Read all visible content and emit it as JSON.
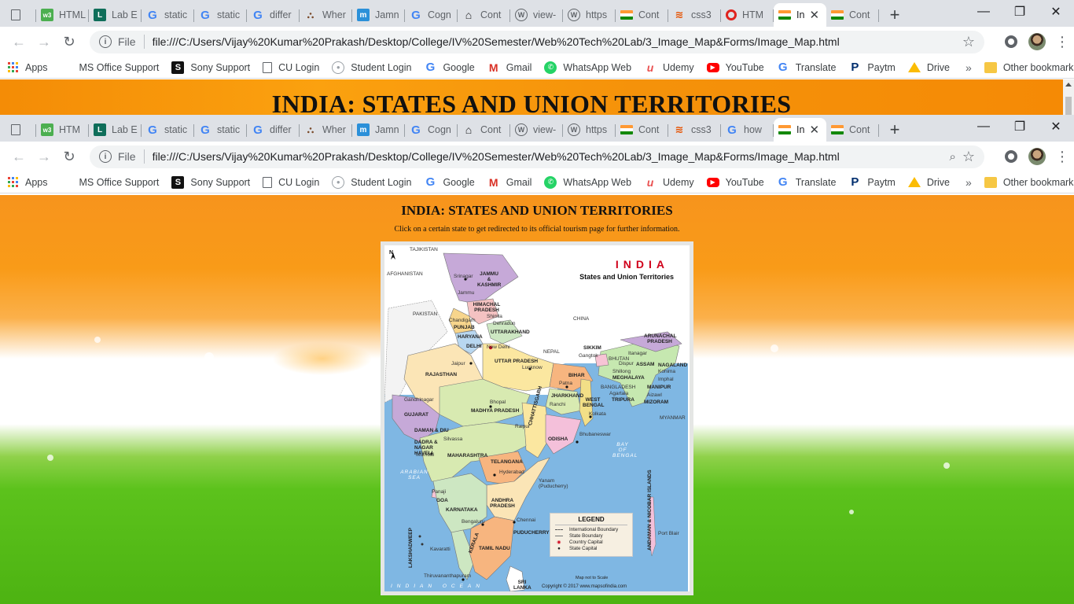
{
  "outer_window": {
    "tabs": [
      {
        "icon": "page-icon",
        "label": ""
      },
      {
        "icon": "w3schools-icon",
        "label": "HTML"
      },
      {
        "icon": "lab-icon",
        "label": "Lab E"
      },
      {
        "icon": "google-icon",
        "label": "static"
      },
      {
        "icon": "google-icon",
        "label": "static"
      },
      {
        "icon": "google-icon",
        "label": "differ"
      },
      {
        "icon": "where-icon",
        "label": "Wher"
      },
      {
        "icon": "m-icon",
        "label": "Jamn"
      },
      {
        "icon": "google-icon",
        "label": "Cogn"
      },
      {
        "icon": "house-icon",
        "label": "Cont"
      },
      {
        "icon": "wordpress-icon",
        "label": "view-"
      },
      {
        "icon": "wordpress-icon",
        "label": "https"
      },
      {
        "icon": "india-flag-icon",
        "label": "Cont"
      },
      {
        "icon": "css-icon",
        "label": "css3"
      },
      {
        "icon": "opera-icon",
        "label": "HTM"
      },
      {
        "icon": "india-flag-icon",
        "label": "In",
        "active": true
      },
      {
        "icon": "india-flag-icon",
        "label": "Cont"
      }
    ],
    "url": "file:///C:/Users/Vijay%20Kumar%20Prakash/Desktop/College/IV%20Semester/Web%20Tech%20Lab/3_Image_Map&Forms/Image_Map.html",
    "file_label": "File",
    "page_heading": "INDIA: STATES AND UNION TERRITORIES"
  },
  "inner_window": {
    "tabs": [
      {
        "icon": "page-icon",
        "label": ""
      },
      {
        "icon": "w3schools-icon",
        "label": "HTM"
      },
      {
        "icon": "lab-icon",
        "label": "Lab E"
      },
      {
        "icon": "google-icon",
        "label": "static"
      },
      {
        "icon": "google-icon",
        "label": "static"
      },
      {
        "icon": "google-icon",
        "label": "differ"
      },
      {
        "icon": "where-icon",
        "label": "Wher"
      },
      {
        "icon": "m-icon",
        "label": "Jamn"
      },
      {
        "icon": "google-icon",
        "label": "Cogn"
      },
      {
        "icon": "house-icon",
        "label": "Cont"
      },
      {
        "icon": "wordpress-icon",
        "label": "view-"
      },
      {
        "icon": "wordpress-icon",
        "label": "https"
      },
      {
        "icon": "india-flag-icon",
        "label": "Cont"
      },
      {
        "icon": "css-icon",
        "label": "css3"
      },
      {
        "icon": "google-icon",
        "label": "how"
      },
      {
        "icon": "india-flag-icon",
        "label": "In",
        "active": true
      },
      {
        "icon": "india-flag-icon",
        "label": "Cont"
      }
    ],
    "url": "file:///C:/Users/Vijay%20Kumar%20Prakash/Desktop/College/IV%20Semester/Web%20Tech%20Lab/3_Image_Map&Forms/Image_Map.html",
    "file_label": "File"
  },
  "bookmarks": [
    {
      "icon": "apps-icon",
      "label": "Apps"
    },
    {
      "icon": "ms-office-icon",
      "label": "MS Office Support"
    },
    {
      "icon": "sony-icon",
      "label": "Sony Support"
    },
    {
      "icon": "page-icon",
      "label": "CU Login"
    },
    {
      "icon": "student-icon",
      "label": "Student Login"
    },
    {
      "icon": "google-icon",
      "label": "Google"
    },
    {
      "icon": "gmail-icon",
      "label": "Gmail"
    },
    {
      "icon": "whatsapp-icon",
      "label": "WhatsApp Web"
    },
    {
      "icon": "udemy-icon",
      "label": "Udemy"
    },
    {
      "icon": "youtube-icon",
      "label": "YouTube"
    },
    {
      "icon": "google-icon",
      "label": "Translate"
    },
    {
      "icon": "paytm-icon",
      "label": "Paytm"
    },
    {
      "icon": "drive-icon",
      "label": "Drive"
    }
  ],
  "more_bookmarks": "»",
  "other_bookmarks": "Other bookmarks",
  "page": {
    "title": "INDIA: STATES AND UNION TERRITORIES",
    "subtitle": "Click on a certain state to get redirected to its official tourism page for further information.",
    "map": {
      "heading": "INDIA",
      "subheading": "States and Union Territories",
      "north": "N",
      "legend_title": "LEGEND",
      "legend_items": [
        "International Boundary",
        "State Boundary",
        "Country Capital",
        "State Capital"
      ],
      "scale_note": "Map not to Scale",
      "copyright": "Copyright © 2017 www.mapsofindia.com",
      "labels": {
        "tajikistan": "TAJIKISTAN",
        "afghanistan": "AFGHANISTAN",
        "pakistan": "PAKISTAN",
        "china": "CHINA",
        "nepal": "NEPAL",
        "bhutan": "BHUTAN",
        "bangladesh": "BANGLADESH",
        "myanmar": "MYANMAR",
        "srilanka": "SRI LANKA",
        "jk": "JAMMU & KASHMIR",
        "srinagar": "Srinagar",
        "jammu": "Jammu",
        "hp": "HIMACHAL PRADESH",
        "shimla": "Shimla",
        "punjab": "PUNJAB",
        "chandigarh": "Chandigarh",
        "haryana": "HARYANA",
        "uttarakhand": "UTTARAKHAND",
        "dehradun": "Dehradun",
        "delhi": "DELHI",
        "newdelhi": "New Delhi",
        "rajasthan": "RAJASTHAN",
        "jaipur": "Jaipur",
        "up": "UTTAR PRADESH",
        "lucknow": "Lucknow",
        "sikkim": "SIKKIM",
        "gangtok": "Gangtok",
        "arunachal": "ARUNACHAL PRADESH",
        "itanagar": "Itanagar",
        "assam": "ASSAM",
        "dispur": "Dispur",
        "nagaland": "NAGALAND",
        "kohima": "Kohima",
        "meghalaya": "MEGHALAYA",
        "shillong": "Shillong",
        "manipur": "MANIPUR",
        "imphal": "Imphal",
        "mizoram": "MIZORAM",
        "aizawl": "Aizawl",
        "tripura": "TRIPURA",
        "agartala": "Agartala",
        "bihar": "BIHAR",
        "patna": "Patna",
        "jharkhand": "JHARKHAND",
        "ranchi": "Ranchi",
        "wb": "WEST BENGAL",
        "kolkata": "Kolkata",
        "gujarat": "GUJARAT",
        "gandhinagar": "Gandhinagar",
        "mp": "MADHYA PRADESH",
        "bhopal": "Bhopal",
        "chhattisgarh": "CHHATTISGARH",
        "raipur": "Raipur",
        "odisha": "ODISHA",
        "bhubaneswar": "Bhubaneswar",
        "daman": "DAMAN & DIU",
        "dnh": "DADRA & NAGAR HAVELI",
        "silvassa": "Silvassa",
        "maharashtra": "MAHARASHTRA",
        "mumbai": "Mumbai",
        "telangana": "TELANGANA",
        "hyderabad": "Hyderabad",
        "goa": "GOA",
        "panaji": "Panaji",
        "ap": "ANDHRA PRADESH",
        "yanam": "Yanam (Puducherry)",
        "karnataka": "KARNATAKA",
        "bengaluru": "Bengaluru",
        "chennai": "Chennai",
        "puducherry": "PUDUCHERRY",
        "tamilnadu": "TAMIL NADU",
        "kerala": "KERALA",
        "thiruvananthapuram": "Thiruvananthapuram",
        "lakshadweep": "LAKSHADWEEP",
        "kavaratti": "Kavaratti",
        "andaman": "ANDAMAN & NICOBAR ISLANDS",
        "portblair": "Port Blair",
        "arabian_sea": "ARABIAN SEA",
        "bay_of_bengal": "BAY OF BENGAL",
        "indian_ocean": "INDIAN OCEAN"
      }
    }
  }
}
